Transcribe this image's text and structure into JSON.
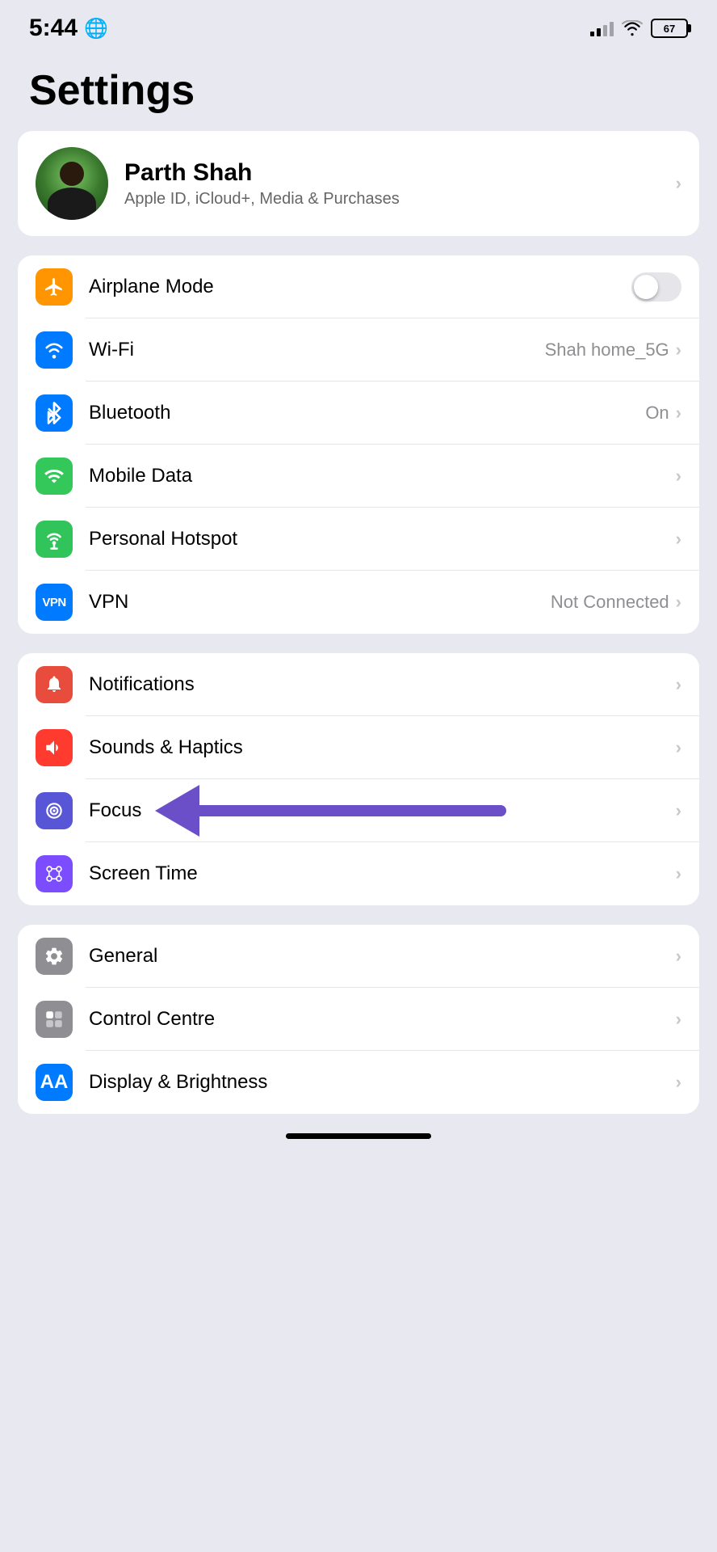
{
  "statusBar": {
    "time": "5:44",
    "battery": "67",
    "batteryPercent": "67%"
  },
  "pageTitle": "Settings",
  "profile": {
    "name": "Parth Shah",
    "subtitle": "Apple ID, iCloud+, Media & Purchases"
  },
  "connectivitySection": {
    "items": [
      {
        "id": "airplane-mode",
        "label": "Airplane Mode",
        "value": "",
        "hasToggle": true,
        "iconBg": "orange"
      },
      {
        "id": "wifi",
        "label": "Wi-Fi",
        "value": "Shah home_5G",
        "hasToggle": false,
        "iconBg": "blue"
      },
      {
        "id": "bluetooth",
        "label": "Bluetooth",
        "value": "On",
        "hasToggle": false,
        "iconBg": "blue"
      },
      {
        "id": "mobile-data",
        "label": "Mobile Data",
        "value": "",
        "hasToggle": false,
        "iconBg": "green"
      },
      {
        "id": "personal-hotspot",
        "label": "Personal Hotspot",
        "value": "",
        "hasToggle": false,
        "iconBg": "green2"
      },
      {
        "id": "vpn",
        "label": "VPN",
        "value": "Not Connected",
        "hasToggle": false,
        "iconBg": "blue"
      }
    ]
  },
  "notificationsSection": {
    "items": [
      {
        "id": "notifications",
        "label": "Notifications",
        "value": "",
        "iconBg": "red"
      },
      {
        "id": "sounds-haptics",
        "label": "Sounds & Haptics",
        "value": "",
        "iconBg": "red2"
      },
      {
        "id": "focus",
        "label": "Focus",
        "value": "",
        "iconBg": "purple",
        "hasArrow": true
      },
      {
        "id": "screen-time",
        "label": "Screen Time",
        "value": "",
        "iconBg": "purple2"
      }
    ]
  },
  "generalSection": {
    "items": [
      {
        "id": "general",
        "label": "General",
        "value": "",
        "iconBg": "gray"
      },
      {
        "id": "control-centre",
        "label": "Control Centre",
        "value": "",
        "iconBg": "gray"
      },
      {
        "id": "display-brightness",
        "label": "Display & Brightness",
        "value": "",
        "iconBg": "blue"
      }
    ]
  },
  "labels": {
    "chevron": "›"
  }
}
